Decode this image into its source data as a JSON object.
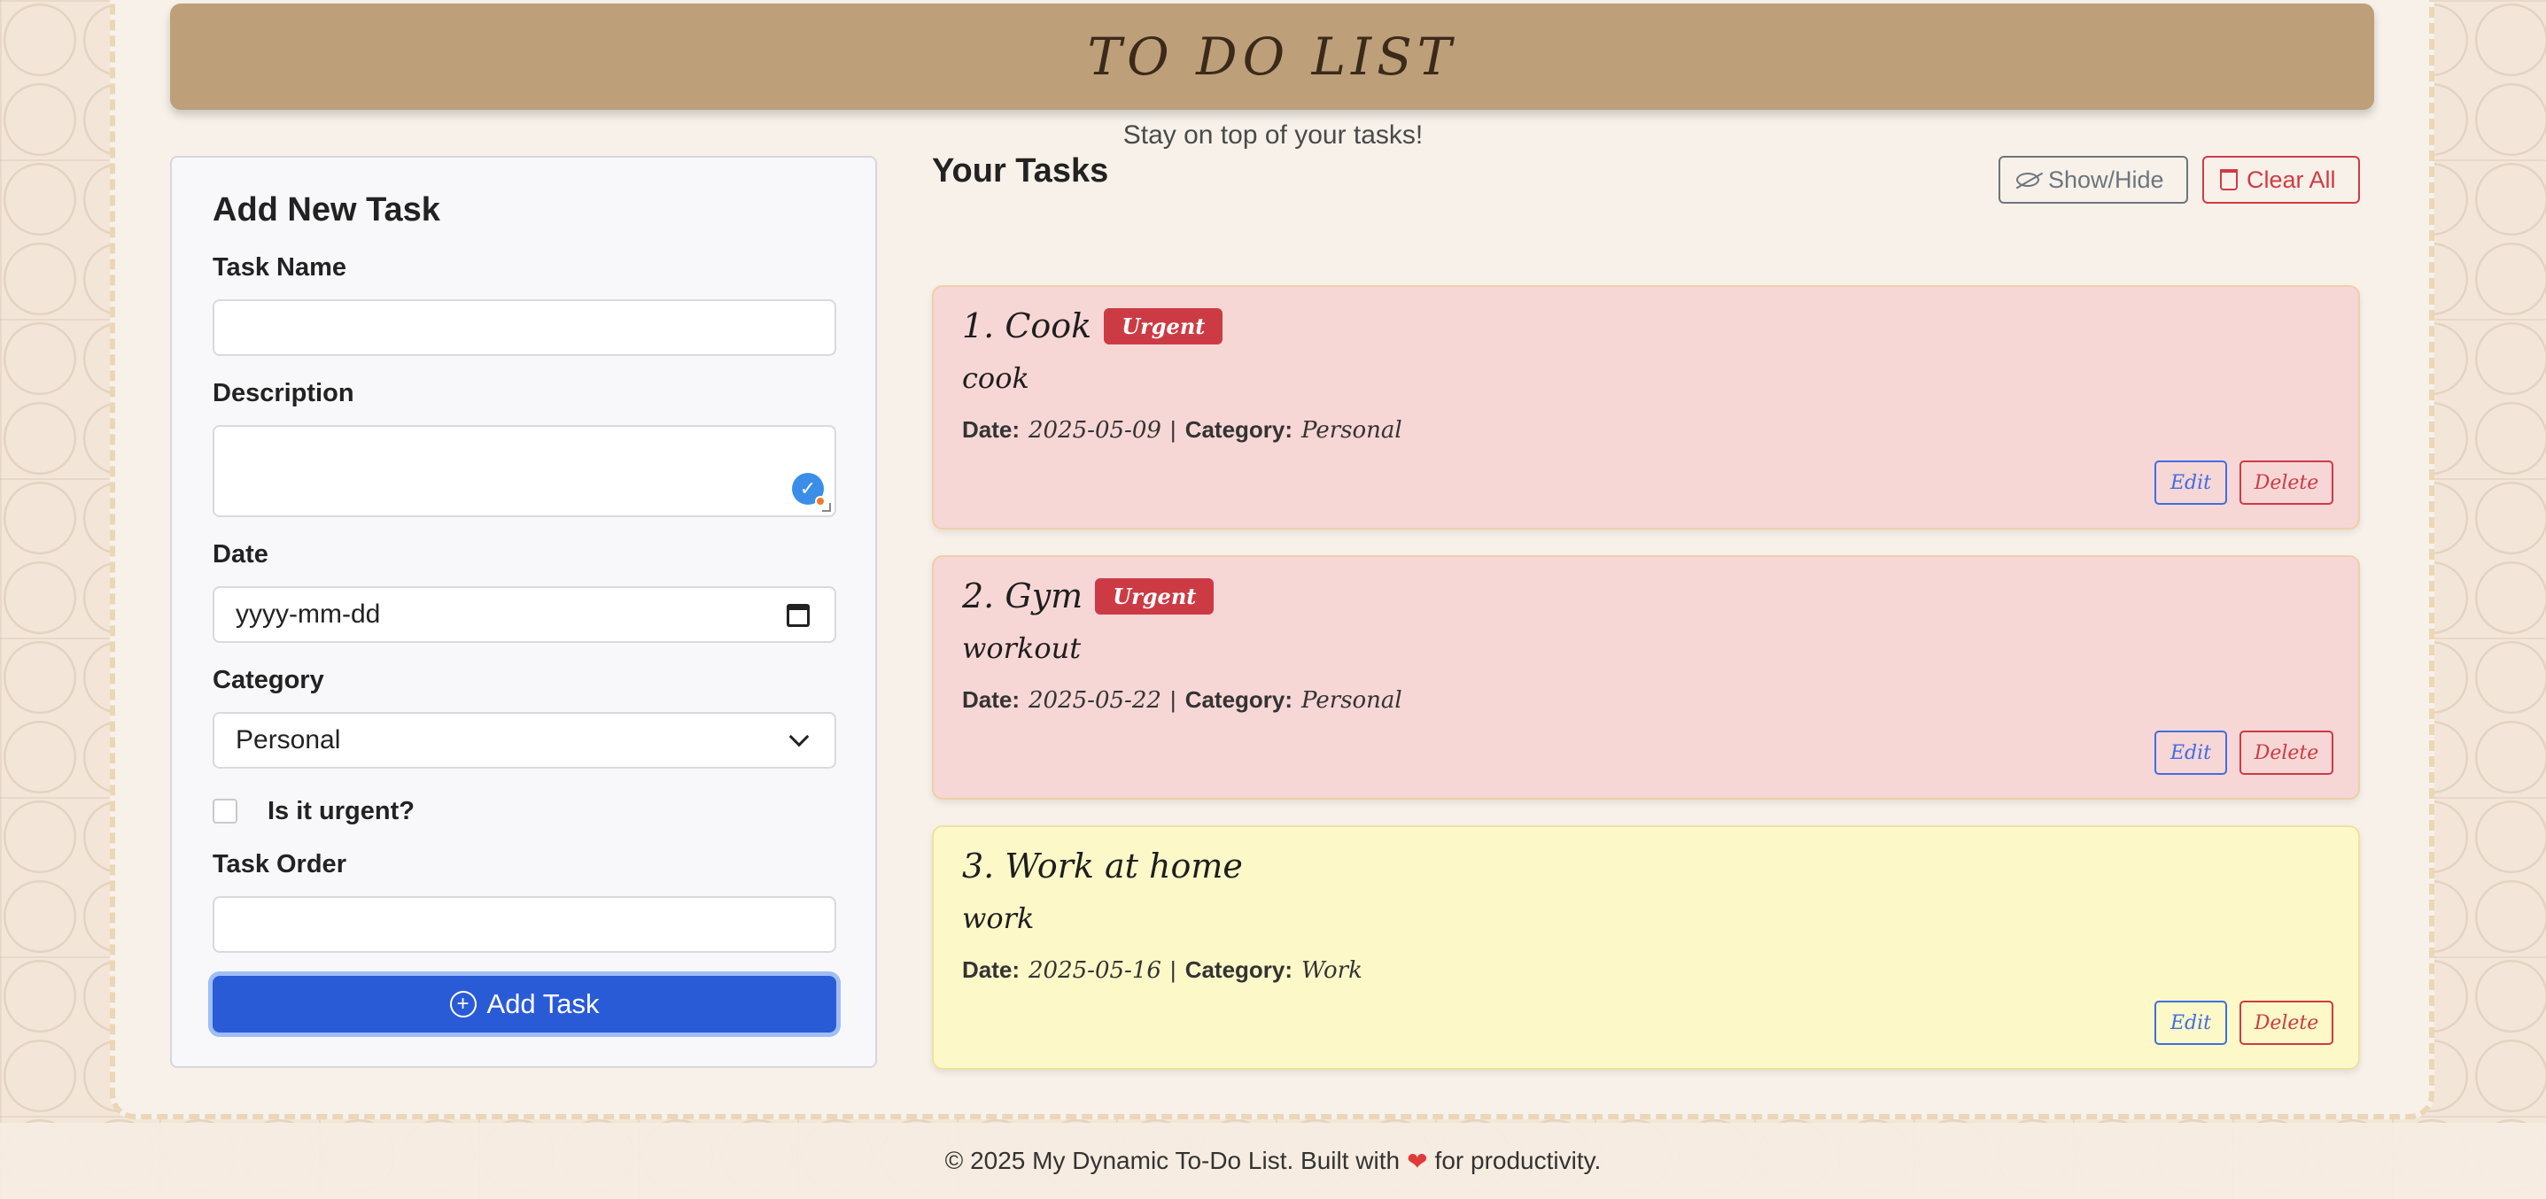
{
  "header": {
    "title": "TO DO LIST",
    "subtitle": "Stay on top of your tasks!"
  },
  "form": {
    "title": "Add New Task",
    "task_name_label": "Task Name",
    "task_name_value": "",
    "description_label": "Description",
    "description_value": "",
    "date_label": "Date",
    "date_placeholder": "yyyy-mm-dd",
    "category_label": "Category",
    "category_selected": "Personal",
    "urgent_label": "Is it urgent?",
    "urgent_checked": false,
    "order_label": "Task Order",
    "order_value": "",
    "add_button": "Add Task"
  },
  "tasks_panel": {
    "title": "Your Tasks",
    "show_hide_label": "Show/Hide",
    "clear_all_label": "Clear All"
  },
  "tasks": [
    {
      "heading": "1. Cook",
      "urgent_label": "Urgent",
      "description": "cook",
      "date_key": "Date:",
      "date": "2025-05-09",
      "separator": "|",
      "category_key": "Category:",
      "category": "Personal",
      "edit": "Edit",
      "delete": "Delete"
    },
    {
      "heading": "2. Gym",
      "urgent_label": "Urgent",
      "description": "workout",
      "date_key": "Date:",
      "date": "2025-05-22",
      "separator": "|",
      "category_key": "Category:",
      "category": "Personal",
      "edit": "Edit",
      "delete": "Delete"
    },
    {
      "heading": "3. Work at home",
      "description": "work",
      "date_key": "Date:",
      "date": "2025-05-16",
      "separator": "|",
      "category_key": "Category:",
      "category": "Work",
      "edit": "Edit",
      "delete": "Delete"
    }
  ],
  "footer": {
    "text_before": "© 2025 My Dynamic To-Do List. Built with",
    "heart": "❤",
    "text_after": "for productivity."
  },
  "icons": {
    "grammar": "grammar-check-icon",
    "calendar": "calendar-icon",
    "chevron": "chevron-down-icon",
    "plus": "plus-circle-icon",
    "eye": "eye-slash-icon",
    "trash": "trash-icon",
    "heart": "heart-icon"
  },
  "colors": {
    "header_bg": "#bd9f7a",
    "primary": "#2a5bd7",
    "danger": "#cc3b44",
    "urgent_card": "#f7d6d6",
    "normal_card": "#fdf8c8"
  }
}
